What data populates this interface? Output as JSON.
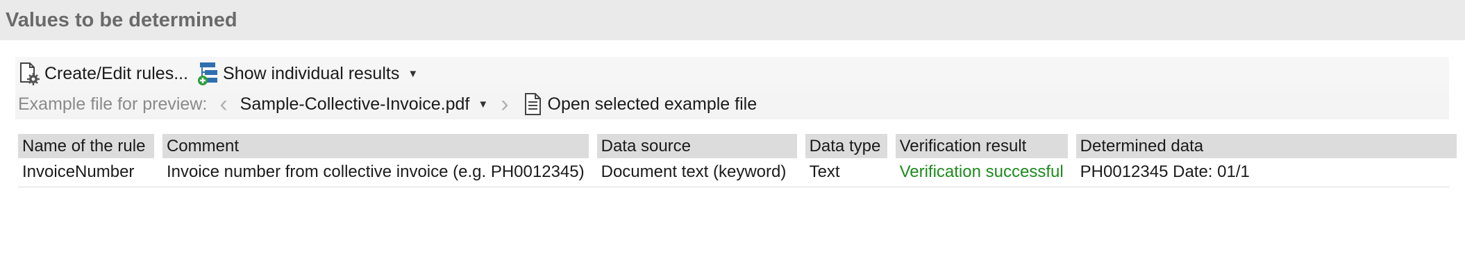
{
  "header": {
    "title": "Values to be determined"
  },
  "toolbar": {
    "create_edit_label": "Create/Edit rules...",
    "show_results_label": "Show individual results",
    "example_label": "Example file for preview:",
    "selected_file": "Sample-Collective-Invoice.pdf",
    "open_example_label": "Open selected example file"
  },
  "table": {
    "headers": [
      "Name of the rule",
      "Comment",
      "Data source",
      "Data type",
      "Verification result",
      "Determined data"
    ],
    "rows": [
      {
        "name": "InvoiceNumber",
        "comment": "Invoice number from collective invoice (e.g. PH0012345)",
        "source": "Document text (keyword)",
        "type": "Text",
        "result": "Verification successful",
        "data": "PH0012345 Date: 01/1"
      }
    ]
  },
  "colors": {
    "success": "#1e8a1e",
    "header_bg": "#eaeaea",
    "column_header_bg": "#dcdcdc"
  },
  "icons": [
    "gear-document-icon",
    "org-chart-add-icon",
    "chevron-down-icon",
    "chevron-left-icon",
    "chevron-right-icon",
    "document-icon"
  ]
}
